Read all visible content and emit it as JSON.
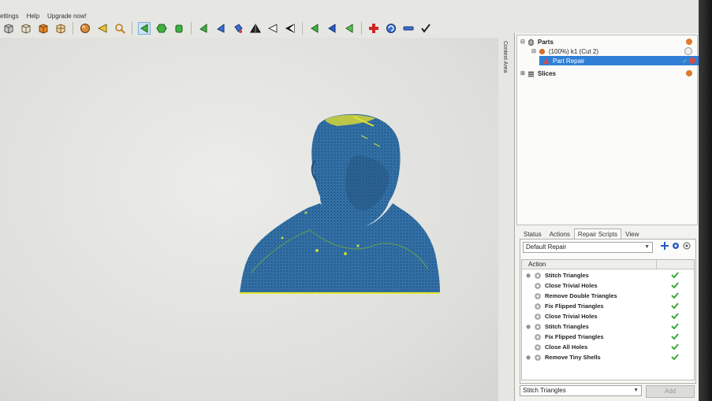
{
  "menubar": {
    "items": [
      "ettings",
      "Help",
      "Upgrade now!"
    ]
  },
  "toolbar": {
    "buttons": [
      "cube-icon",
      "cube-outline-icon",
      "cube-orange-icon",
      "cube-grid-icon",
      "sphere-icon",
      "arrow-left-icon",
      "zoom-icon",
      "pyramid-select-icon",
      "hexagon-icon",
      "cylinder-icon",
      "triangle-green-icon",
      "triangle-blue-icon",
      "paint-bucket-icon",
      "pyramid-icon",
      "pyramid-white-icon",
      "pyramid-black-icon",
      "arrow-green-icon",
      "arrow-blue-icon",
      "arrow-green-2-icon",
      "add-red-icon",
      "refresh-icon",
      "minus-icon",
      "check-icon"
    ]
  },
  "context_area": {
    "label": "Context Area"
  },
  "tree": {
    "items": [
      {
        "label": "Parts",
        "bold": true
      },
      {
        "label": "(100%) k1 (Cut 2)",
        "bold": false
      },
      {
        "label": "Part Repair",
        "bold": false,
        "selected": true
      },
      {
        "label": "Slices",
        "bold": true
      }
    ]
  },
  "tabs": {
    "items": [
      "Status",
      "Actions",
      "Repair Scripts",
      "View"
    ],
    "active": "Repair Scripts"
  },
  "repair": {
    "script_select": "Default Repair",
    "column_header": "Action",
    "actions": [
      {
        "label": "Stitch Triangles",
        "expandable": true
      },
      {
        "label": "Close Trivial Holes",
        "expandable": false
      },
      {
        "label": "Remove Double Triangles",
        "expandable": false
      },
      {
        "label": "Fix Flipped Triangles",
        "expandable": false
      },
      {
        "label": "Close Trivial Holes",
        "expandable": false
      },
      {
        "label": "Stitch Triangles",
        "expandable": true
      },
      {
        "label": "Fix Flipped Triangles",
        "expandable": false
      },
      {
        "label": "Close All Holes",
        "expandable": false
      },
      {
        "label": "Remove Tiny Shells",
        "expandable": true
      }
    ],
    "bottom_select": "Stitch Triangles",
    "add_button": "Add"
  },
  "colors": {
    "accent": "#2f7fd6",
    "check": "#3aa83a",
    "mesh": "#2f6fa6"
  }
}
